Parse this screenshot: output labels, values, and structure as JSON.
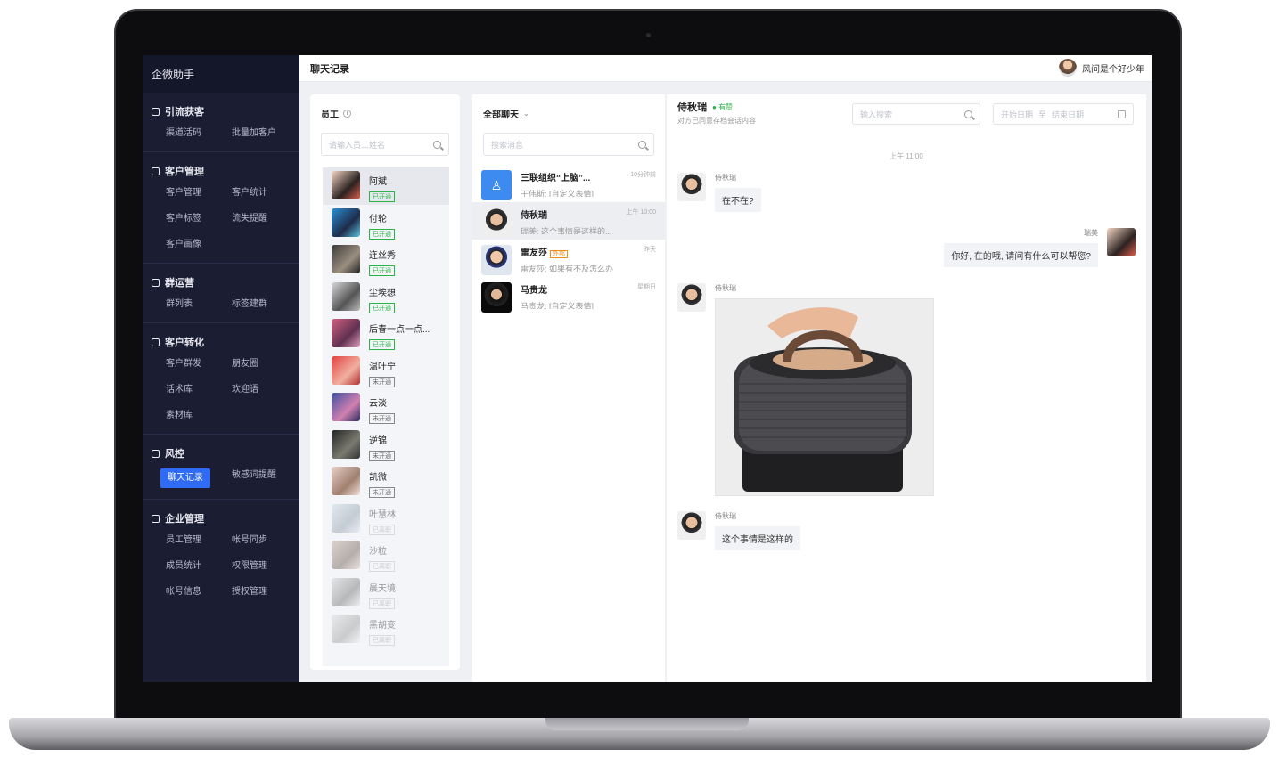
{
  "sidebar": {
    "title": "企微助手",
    "groups": [
      {
        "title": "引流获客",
        "items": [
          "渠道活码",
          "批量加客户"
        ]
      },
      {
        "title": "客户管理",
        "items": [
          "客户管理",
          "客户统计",
          "客户标签",
          "流失提醒",
          "客户画像"
        ]
      },
      {
        "title": "群运营",
        "items": [
          "群列表",
          "标签建群"
        ]
      },
      {
        "title": "客户转化",
        "items": [
          "客户群发",
          "朋友圈",
          "话术库",
          "欢迎语",
          "素材库"
        ]
      },
      {
        "title": "风控",
        "items": [
          "聊天记录",
          "敏感词提醒"
        ]
      },
      {
        "title": "企业管理",
        "items": [
          "员工管理",
          "帐号同步",
          "成员统计",
          "权限管理",
          "帐号信息",
          "授权管理"
        ]
      }
    ]
  },
  "topbar": {
    "page_title": "聊天记录",
    "user_name": "风间是个好少年"
  },
  "employees": {
    "title": "员工",
    "search_placeholder": "请输入员工姓名",
    "list": [
      {
        "name": "阿斌",
        "status": "已开通"
      },
      {
        "name": "付轮",
        "status": "已开通"
      },
      {
        "name": "连丝秀",
        "status": "已开通"
      },
      {
        "name": "尘埃想",
        "status": "已开通"
      },
      {
        "name": "后春一点一点...",
        "status": "已开通"
      },
      {
        "name": "温叶宁",
        "status": "未开通"
      },
      {
        "name": "云淡",
        "status": "未开通"
      },
      {
        "name": "逆锦",
        "status": "未开通"
      },
      {
        "name": "凯微",
        "status": "未开通"
      },
      {
        "name": "叶慧林",
        "status": "已离职"
      },
      {
        "name": "沙粒",
        "status": "已离职"
      },
      {
        "name": "晨天境",
        "status": "已离职"
      },
      {
        "name": "黑胡变",
        "status": "已离职"
      }
    ]
  },
  "chats": {
    "filter": "全部聊天",
    "search_placeholder": "搜索消息",
    "list": [
      {
        "name": "三联组织“上脑”...",
        "time": "10分钟前",
        "preview": "于伟斯: [自定义表情]",
        "tag": ""
      },
      {
        "name": "侍秋瑞",
        "time": "上午 10:00",
        "preview": "瑞美: 这个事情是这样的...",
        "tag": ""
      },
      {
        "name": "雷友莎",
        "time": "昨天",
        "preview": "雷友莎: 如果有不及怎么办",
        "tag": "外部"
      },
      {
        "name": "马贵龙",
        "time": "星期日",
        "preview": "马贵龙: [自定义表情]",
        "tag": ""
      }
    ]
  },
  "conversation": {
    "name": "侍秋瑞",
    "status": "有赞",
    "subtitle": "对方已同意存档会话内容",
    "search_placeholder": "输入搜索",
    "start_date": "开始日期",
    "date_sep": "至",
    "end_date": "结束日期",
    "time_sep": "上午 11:00",
    "messages": [
      {
        "sender": "侍秋瑞",
        "text": "在不在?"
      },
      {
        "sender": "瑞美",
        "text": "你好, 在的哦, 请问有什么可以帮您?"
      },
      {
        "sender": "侍秋瑞",
        "text": ""
      },
      {
        "sender": "侍秋瑞",
        "text": "这个事情是这样的"
      }
    ]
  },
  "colors": {
    "sidebar_bg": "#1b1d33",
    "accent": "#2f6bf5",
    "green": "#28b446"
  }
}
